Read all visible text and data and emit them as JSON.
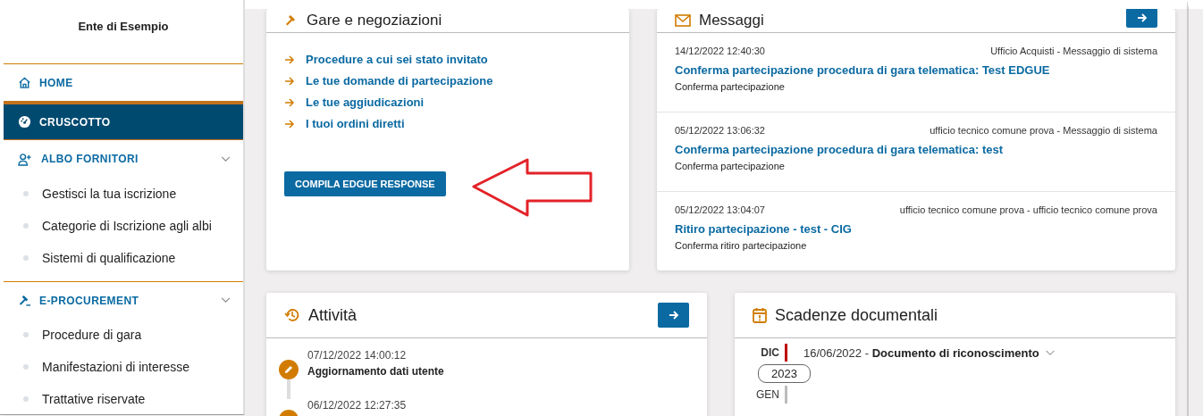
{
  "sidebar": {
    "org_name": "Ente di Esempio",
    "items": [
      {
        "label": "HOME",
        "kind": "home",
        "selected": false
      },
      {
        "label": "CRUSCOTTO",
        "kind": "dashboard",
        "selected": true
      },
      {
        "label": "ALBO FORNITORI",
        "kind": "suppliers",
        "selected": false,
        "expanded": true,
        "children": [
          {
            "label": "Gestisci la tua iscrizione"
          },
          {
            "label": "Categorie di Iscrizione agli albi"
          },
          {
            "label": "Sistemi di qualificazione"
          }
        ]
      },
      {
        "label": "E-PROCUREMENT",
        "kind": "procurement",
        "selected": false,
        "expanded": true,
        "children": [
          {
            "label": "Procedure di gara"
          },
          {
            "label": "Manifestazioni di interesse"
          },
          {
            "label": "Trattative riservate"
          }
        ]
      }
    ]
  },
  "gare": {
    "title": "Gare e negoziazioni",
    "links": [
      "Procedure a cui sei stato invitato",
      "Le tue domande di partecipazione",
      "Le tue aggiudicazioni",
      "I tuoi ordini diretti"
    ],
    "button": "COMPILA EDGUE RESPONSE"
  },
  "messaggi": {
    "title": "Messaggi",
    "items": [
      {
        "date": "14/12/2022 12:40:30",
        "sender": "Ufficio Acquisti - Messaggio di sistema",
        "subject": "Conferma partecipazione procedura di gara telematica: Test EDGUE",
        "body": "Conferma partecipazione"
      },
      {
        "date": "05/12/2022 13:06:32",
        "sender": "ufficio tecnico comune prova - Messaggio di sistema",
        "subject": "Conferma partecipazione procedura di gara telematica: test",
        "body": "Conferma partecipazione"
      },
      {
        "date": "05/12/2022 13:04:07",
        "sender": "ufficio tecnico comune prova - ufficio tecnico comune prova",
        "subject": "Ritiro partecipazione - test - CIG",
        "body": "Conferma ritiro partecipazione"
      }
    ]
  },
  "attivita": {
    "title": "Attività",
    "items": [
      {
        "date": "07/12/2022 14:00:12",
        "text": "Aggiornamento dati utente"
      },
      {
        "date": "06/12/2022 12:27:35"
      }
    ]
  },
  "scadenze": {
    "title": "Scadenze documentali",
    "rows": [
      {
        "kind": "month",
        "month": "DIC",
        "color": "#c00000",
        "date": "16/06/2022 - ",
        "document": "Documento di riconoscimento"
      },
      {
        "kind": "year",
        "year": "2023"
      },
      {
        "kind": "month",
        "month": "GEN",
        "color": "#bbbbbb"
      }
    ]
  }
}
